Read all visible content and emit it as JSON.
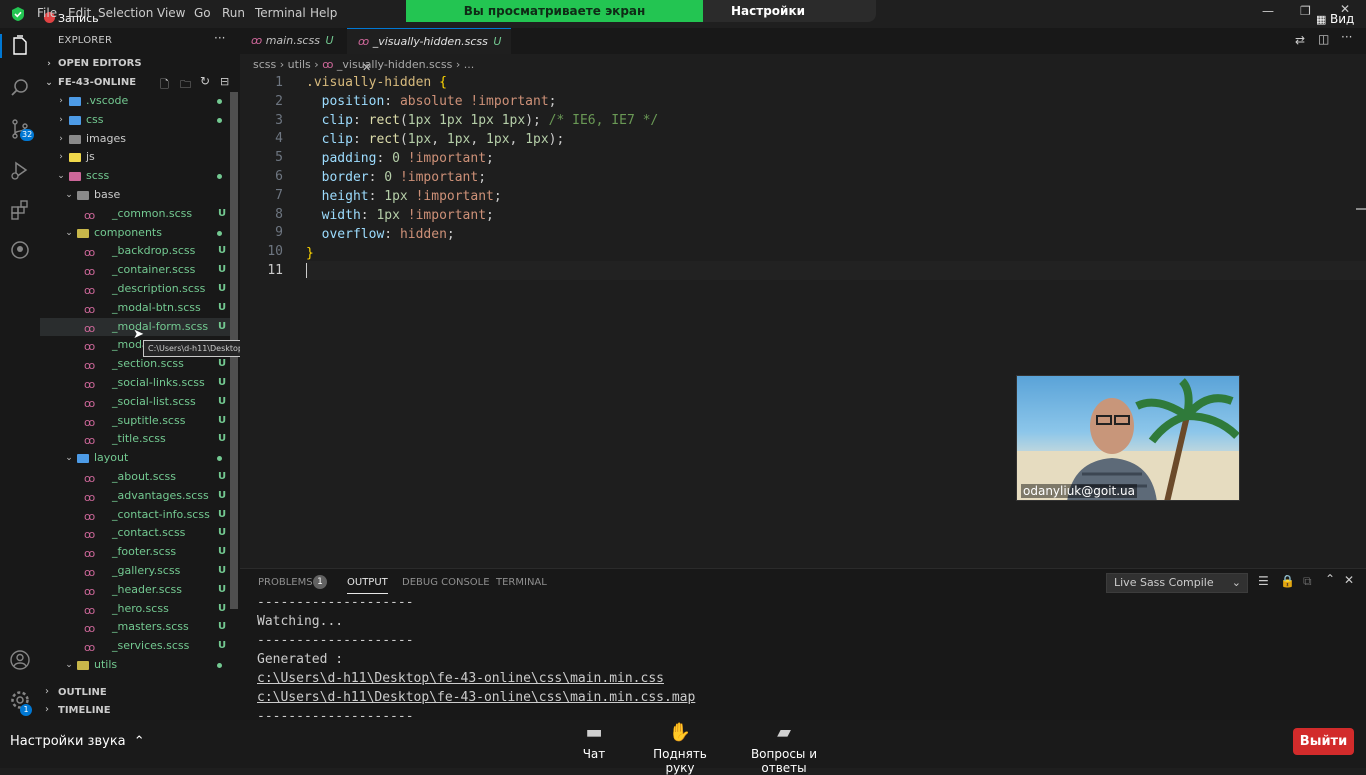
{
  "recording": {
    "label": "Запись"
  },
  "menu": [
    "File",
    "Edit",
    "Selection",
    "View",
    "Go",
    "Run",
    "Terminal",
    "Help"
  ],
  "share": {
    "banner": "Вы просматриваете экран odanyliuk@goit.ua",
    "view_settings": "Настройки просмотра",
    "view_label": "Вид"
  },
  "sidebar": {
    "title": "EXPLORER",
    "open_editors": "OPEN EDITORS",
    "project": "FE-43-ONLINE",
    "outline": "OUTLINE",
    "timeline": "TIMELINE",
    "source_control_count": "32",
    "accounts_badge": "1",
    "tree": [
      {
        "name": ".vscode",
        "depth": 1,
        "type": "folder",
        "color": "#4d9be6",
        "open": false,
        "status": "dot"
      },
      {
        "name": "css",
        "depth": 1,
        "type": "folder",
        "color": "#4d9be6",
        "open": false,
        "status": "dot"
      },
      {
        "name": "images",
        "depth": 1,
        "type": "folder",
        "color": "#8a8a8a",
        "open": false,
        "status": ""
      },
      {
        "name": "js",
        "depth": 1,
        "type": "folder",
        "color": "#f0d84b",
        "open": false,
        "status": ""
      },
      {
        "name": "scss",
        "depth": 1,
        "type": "folder",
        "color": "#cd6799",
        "open": true,
        "status": "dot"
      },
      {
        "name": "base",
        "depth": 2,
        "type": "folder",
        "color": "#8a8a8a",
        "open": true,
        "status": ""
      },
      {
        "name": "_common.scss",
        "depth": 3,
        "type": "file",
        "status": "U"
      },
      {
        "name": "components",
        "depth": 2,
        "type": "folder",
        "color": "#c8b74a",
        "open": true,
        "status": "dot"
      },
      {
        "name": "_backdrop.scss",
        "depth": 3,
        "type": "file",
        "status": "U"
      },
      {
        "name": "_container.scss",
        "depth": 3,
        "type": "file",
        "status": "U"
      },
      {
        "name": "_description.scss",
        "depth": 3,
        "type": "file",
        "status": "U"
      },
      {
        "name": "_modal-btn.scss",
        "depth": 3,
        "type": "file",
        "status": "U"
      },
      {
        "name": "_modal-form.scss",
        "depth": 3,
        "type": "file",
        "status": "U",
        "selected": true
      },
      {
        "name": "_modal.",
        "depth": 3,
        "type": "file",
        "status": ""
      },
      {
        "name": "_section.scss",
        "depth": 3,
        "type": "file",
        "status": "U"
      },
      {
        "name": "_social-links.scss",
        "depth": 3,
        "type": "file",
        "status": "U"
      },
      {
        "name": "_social-list.scss",
        "depth": 3,
        "type": "file",
        "status": "U"
      },
      {
        "name": "_suptitle.scss",
        "depth": 3,
        "type": "file",
        "status": "U"
      },
      {
        "name": "_title.scss",
        "depth": 3,
        "type": "file",
        "status": "U"
      },
      {
        "name": "layout",
        "depth": 2,
        "type": "folder",
        "color": "#4d9be6",
        "open": true,
        "status": "dot"
      },
      {
        "name": "_about.scss",
        "depth": 3,
        "type": "file",
        "status": "U"
      },
      {
        "name": "_advantages.scss",
        "depth": 3,
        "type": "file",
        "status": "U"
      },
      {
        "name": "_contact-info.scss",
        "depth": 3,
        "type": "file",
        "status": "U"
      },
      {
        "name": "_contact.scss",
        "depth": 3,
        "type": "file",
        "status": "U"
      },
      {
        "name": "_footer.scss",
        "depth": 3,
        "type": "file",
        "status": "U"
      },
      {
        "name": "_gallery.scss",
        "depth": 3,
        "type": "file",
        "status": "U"
      },
      {
        "name": "_header.scss",
        "depth": 3,
        "type": "file",
        "status": "U"
      },
      {
        "name": "_hero.scss",
        "depth": 3,
        "type": "file",
        "status": "U"
      },
      {
        "name": "_masters.scss",
        "depth": 3,
        "type": "file",
        "status": "U"
      },
      {
        "name": "_services.scss",
        "depth": 3,
        "type": "file",
        "status": "U"
      },
      {
        "name": "utils",
        "depth": 2,
        "type": "folder",
        "color": "#c8b74a",
        "open": true,
        "status": "dot"
      }
    ]
  },
  "tooltip": "C:\\Users\\d-h11\\Desktop\\fe-43-online\\scss\\components\\_modal-form.scss • Untracked",
  "tabs": [
    {
      "name": "main.scss",
      "status": "U",
      "active": false
    },
    {
      "name": "_visually-hidden.scss",
      "status": "U",
      "active": true
    }
  ],
  "breadcrumb": [
    "scss",
    "utils",
    "_visually-hidden.scss",
    "..."
  ],
  "editor": {
    "line_numbers": [
      "1",
      "2",
      "3",
      "4",
      "5",
      "6",
      "7",
      "8",
      "9",
      "10",
      "11"
    ],
    "active_line": 11
  },
  "panel": {
    "tabs": [
      "PROBLEMS",
      "OUTPUT",
      "DEBUG CONSOLE",
      "TERMINAL"
    ],
    "problems_count": "1",
    "active_tab": "OUTPUT",
    "output_channel": "Live Sass Compile",
    "output_lines": [
      "--------------------",
      "Watching...",
      "--------------------",
      "Generated :",
      "c:\\Users\\d-h11\\Desktop\\fe-43-online\\css\\main.min.css",
      "c:\\Users\\d-h11\\Desktop\\fe-43-online\\css\\main.min.css.map",
      "--------------------"
    ]
  },
  "video": {
    "name": "odanyliuk@goit.ua"
  },
  "zoom": {
    "audio_settings": "Настройки звука",
    "chat": "Чат",
    "raise_hand": "Поднять руку",
    "qa": "Вопросы и ответы",
    "leave": "Выйти"
  }
}
